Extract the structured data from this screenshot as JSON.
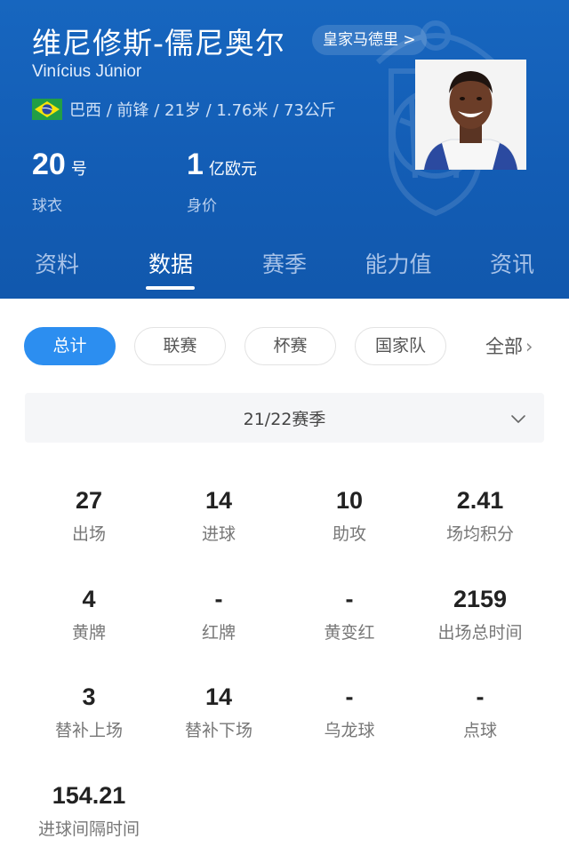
{
  "player": {
    "name_cn": "维尼修斯-儒尼奥尔",
    "name_en": "Vinícius Júnior",
    "club_link": "皇家马德里 >",
    "info": "巴西 / 前锋 / 21岁 / 1.76米 / 73公斤",
    "flag_icon": "brazil-flag-icon",
    "shirt": {
      "number": "20",
      "unit": "号",
      "label": "球衣"
    },
    "value": {
      "number": "1",
      "unit": "亿欧元",
      "label": "身价"
    }
  },
  "colors": {
    "header_blue": "#1563b9",
    "accent_blue": "#2c8ef0"
  },
  "tabs": [
    {
      "label": "资料",
      "active": false
    },
    {
      "label": "数据",
      "active": true
    },
    {
      "label": "赛季",
      "active": false
    },
    {
      "label": "能力值",
      "active": false
    },
    {
      "label": "资讯",
      "active": false
    }
  ],
  "filters": [
    {
      "label": "总计",
      "active": true
    },
    {
      "label": "联赛",
      "active": false
    },
    {
      "label": "杯赛",
      "active": false
    },
    {
      "label": "国家队",
      "active": false
    }
  ],
  "filter_all": {
    "label": "全部",
    "icon": "chevron-right-icon"
  },
  "season": {
    "label": "21/22赛季",
    "icon": "chevron-down-icon"
  },
  "stats": [
    {
      "value": "27",
      "label": "出场"
    },
    {
      "value": "14",
      "label": "进球"
    },
    {
      "value": "10",
      "label": "助攻"
    },
    {
      "value": "2.41",
      "label": "场均积分"
    },
    {
      "value": "4",
      "label": "黄牌"
    },
    {
      "value": "-",
      "label": "红牌"
    },
    {
      "value": "-",
      "label": "黄变红"
    },
    {
      "value": "2159",
      "label": "出场总时间"
    },
    {
      "value": "3",
      "label": "替补上场"
    },
    {
      "value": "14",
      "label": "替补下场"
    },
    {
      "value": "-",
      "label": "乌龙球"
    },
    {
      "value": "-",
      "label": "点球"
    },
    {
      "value": "154.21",
      "label": "进球间隔时间"
    }
  ]
}
